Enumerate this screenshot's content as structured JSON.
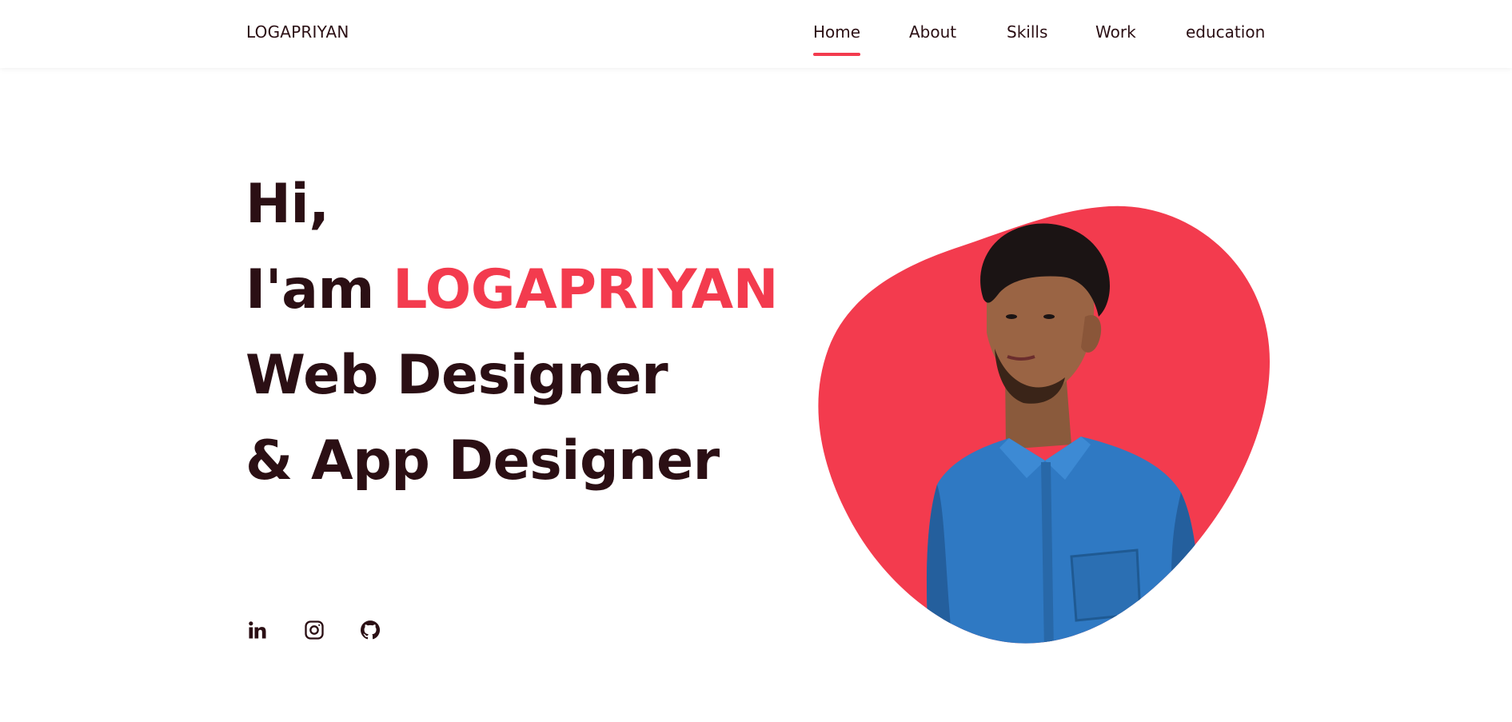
{
  "header": {
    "logo": "LOGAPRIYAN",
    "nav": [
      "Home",
      "About",
      "Skills",
      "Work",
      "education"
    ],
    "active_nav": "Home"
  },
  "hero": {
    "greeting": "Hi,",
    "intro_prefix": "I'am",
    "name": "LOGAPRIYAN",
    "role_line1": "Web Designer",
    "role_line2": "& App Designer"
  },
  "socials": [
    {
      "icon": "linkedin-icon"
    },
    {
      "icon": "instagram-icon"
    },
    {
      "icon": "github-icon"
    }
  ],
  "colors": {
    "accent": "#f33b4e",
    "text": "#2b0f14",
    "background": "#ffffff"
  }
}
